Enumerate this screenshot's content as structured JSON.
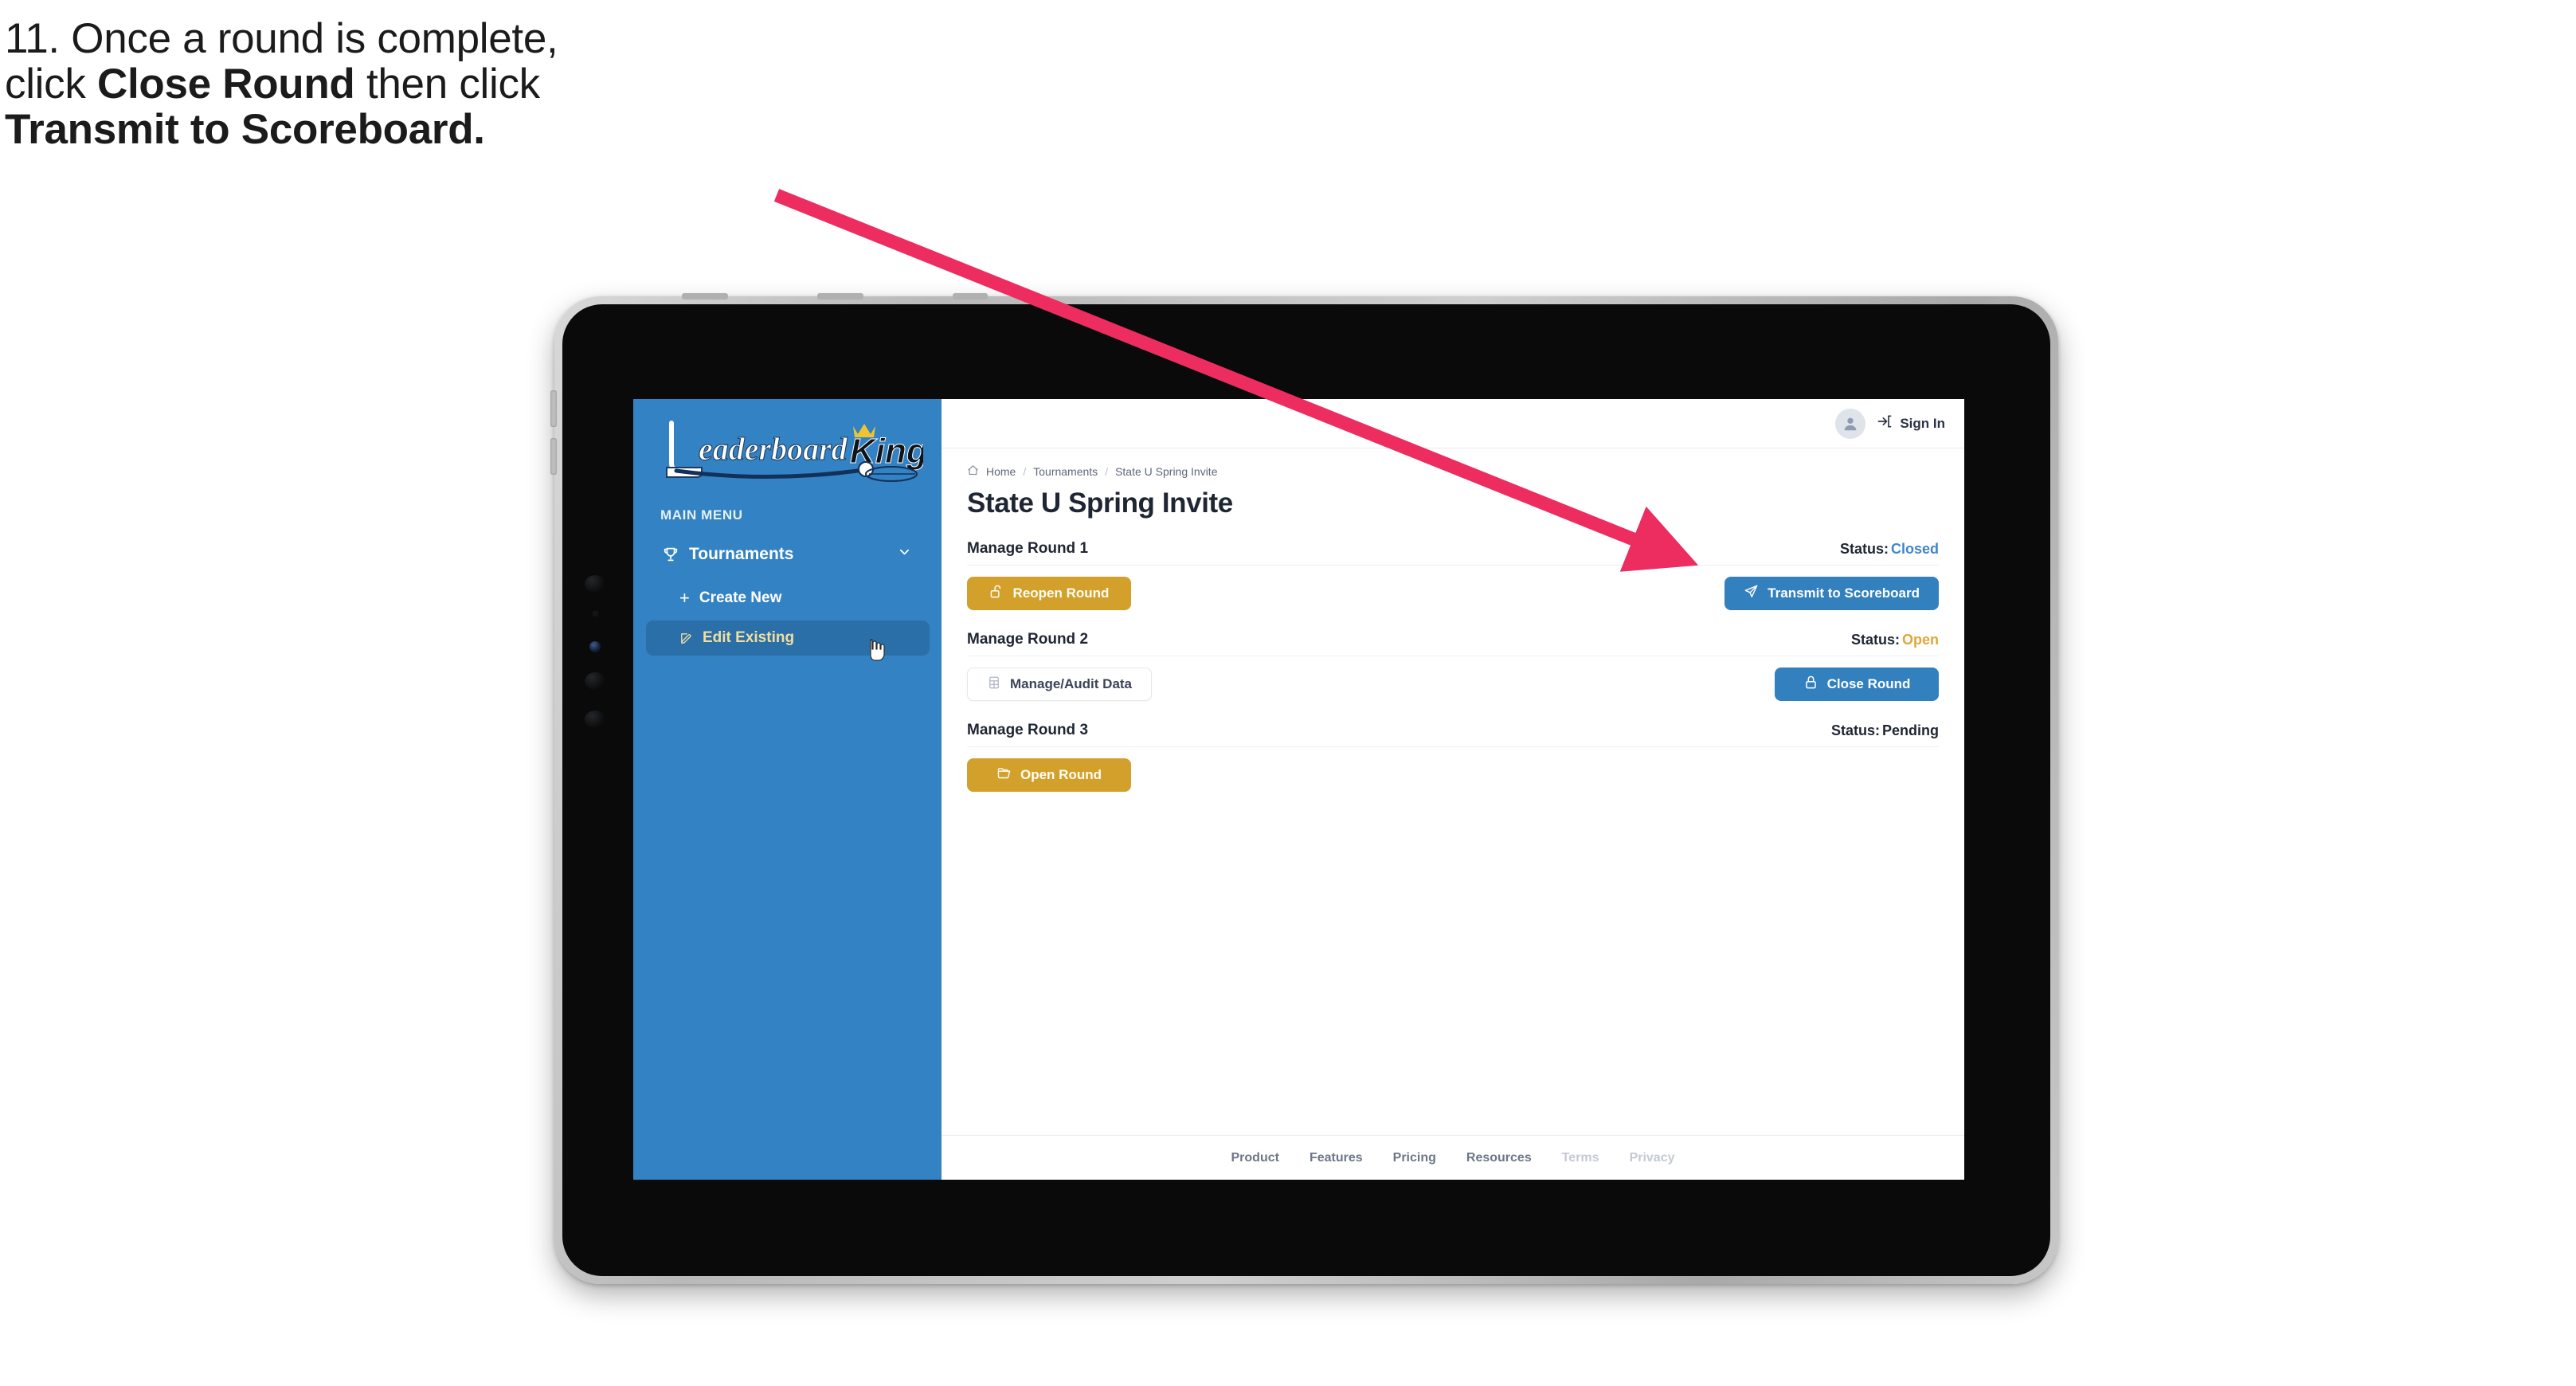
{
  "caption": {
    "line1_plain": "11. Once a round is complete,",
    "line2_pre": "click ",
    "line2_bold": "Close Round",
    "line2_post": " then click",
    "line3_bold": "Transmit to Scoreboard."
  },
  "annotation": {
    "arrow_color": "#ED2D60",
    "arrow_from": "975,245",
    "arrow_to": "2120,705"
  },
  "sidebar": {
    "logo_text_1": "eaderboard",
    "logo_text_2": "King",
    "section_label": "MAIN MENU",
    "items": [
      {
        "label": "Tournaments",
        "icon": "trophy-icon",
        "chevron": "chevron-down-icon",
        "active": false
      },
      {
        "label": "Create New",
        "icon": "plus-icon",
        "active": false
      },
      {
        "label": "Edit Existing",
        "icon": "pencil-square-icon",
        "active": true
      }
    ],
    "bg_color": "#3382C3",
    "active_bg_color": "#2B6FA8",
    "active_text_color": "#F0DFA0"
  },
  "topbar": {
    "avatar_icon": "user-avatar-icon",
    "signin_icon": "sign-in-arrow-icon",
    "signin_label": "Sign In"
  },
  "breadcrumb": {
    "home_icon": "home-icon",
    "items": [
      "Home",
      "Tournaments",
      "State U Spring Invite"
    ],
    "separator": "/"
  },
  "page": {
    "title": "State U Spring Invite"
  },
  "rounds": [
    {
      "title": "Manage Round 1",
      "status_label": "Status:",
      "status_value": "Closed",
      "status_color": "#3F86CC",
      "left_button": {
        "label": "Reopen Round",
        "icon": "unlock-icon",
        "style": "gold"
      },
      "right_button": {
        "label": "Transmit to Scoreboard",
        "icon": "paper-plane-icon",
        "style": "blue"
      }
    },
    {
      "title": "Manage Round 2",
      "status_label": "Status:",
      "status_value": "Open",
      "status_color": "#E0A63A",
      "left_button": {
        "label": "Manage/Audit Data",
        "icon": "table-grid-icon",
        "style": "ghost"
      },
      "right_button": {
        "label": "Close Round",
        "icon": "lock-icon",
        "style": "blue"
      }
    },
    {
      "title": "Manage Round 3",
      "status_label": "Status:",
      "status_value": "Pending",
      "status_color": "#1F2633",
      "left_button": {
        "label": "Open Round",
        "icon": "open-folder-icon",
        "style": "gold"
      },
      "right_button": null
    }
  ],
  "footer": {
    "links": [
      {
        "label": "Product",
        "muted": false
      },
      {
        "label": "Features",
        "muted": false
      },
      {
        "label": "Pricing",
        "muted": false
      },
      {
        "label": "Resources",
        "muted": false
      },
      {
        "label": "Terms",
        "muted": true
      },
      {
        "label": "Privacy",
        "muted": true
      }
    ]
  },
  "colors": {
    "brand_blue": "#3382C3",
    "brand_gold": "#D3A02C",
    "button_blue": "#3380BF",
    "annotation_pink": "#ED2D60"
  }
}
